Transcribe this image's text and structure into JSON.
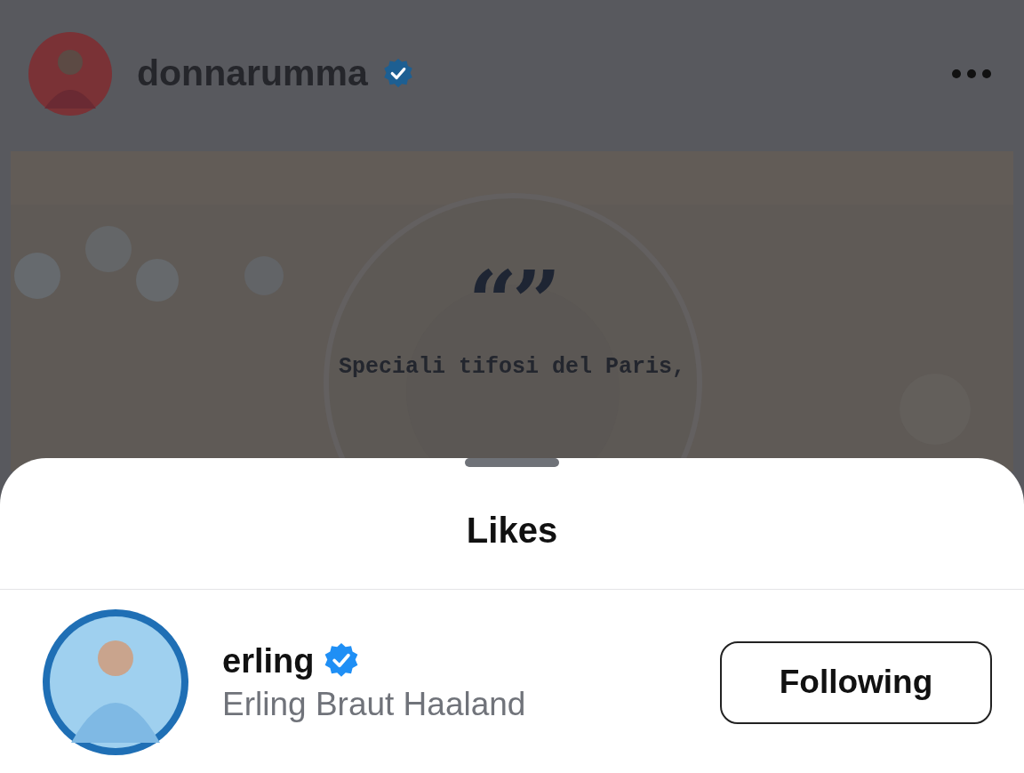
{
  "post": {
    "author": {
      "username": "donnarumma",
      "verified": true
    },
    "quote_mark": "“”",
    "caption": "Speciali tifosi del Paris,"
  },
  "likes_sheet": {
    "title": "Likes",
    "users": [
      {
        "username": "erling",
        "verified": true,
        "full_name": "Erling Braut Haaland",
        "button": "Following"
      }
    ]
  }
}
